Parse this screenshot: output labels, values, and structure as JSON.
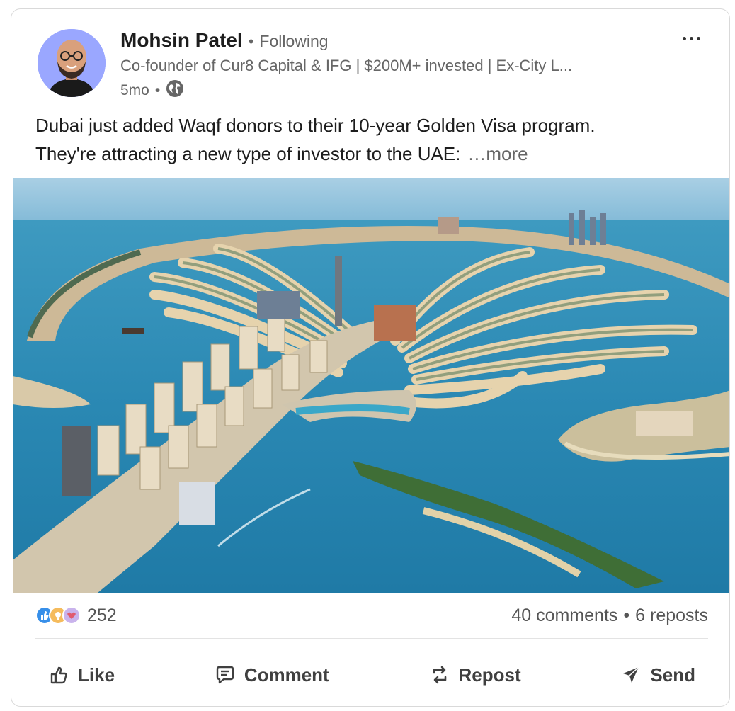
{
  "author": {
    "name": "Mohsin Patel",
    "separator": "•",
    "follow_status": "Following",
    "headline": "Co-founder of Cur8 Capital & IFG | $200M+ invested | Ex-City L...",
    "time": "5mo",
    "time_separator": "•",
    "visibility_icon": "globe-icon"
  },
  "post": {
    "line1": "Dubai just added Waqf donors to their 10-year Golden Visa program.",
    "line2": "They're attracting a new type of investor to the UAE:",
    "see_more": "…more"
  },
  "social": {
    "reaction_icons": [
      "like-reaction-icon",
      "insightful-reaction-icon",
      "support-reaction-icon"
    ],
    "reaction_count": "252",
    "comments": "40 comments",
    "dot": "•",
    "reposts": "6 reposts"
  },
  "actions": {
    "like": "Like",
    "comment": "Comment",
    "repost": "Repost",
    "send": "Send"
  },
  "colors": {
    "accent": "#0a66c2",
    "text_primary": "#1d1d1d",
    "text_secondary": "#666666",
    "like_blue": "#378fe9",
    "insight_yellow": "#f5bb5c",
    "support_purple": "#c9b3ec"
  }
}
